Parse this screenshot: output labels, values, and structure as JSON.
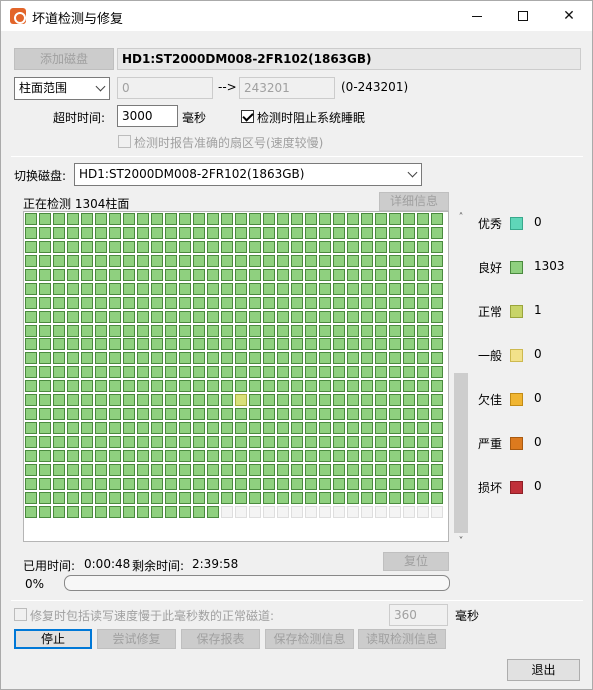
{
  "window": {
    "title": "坏道检测与修复",
    "minimize": "",
    "maximize": "",
    "close": "✕"
  },
  "top": {
    "add_disk_label": "添加磁盘",
    "disk_name": "HD1:ST2000DM008-2FR102(1863GB)",
    "range_mode": "柱面范围",
    "range_start": "0",
    "range_arrow": "-->",
    "range_end": "243201",
    "range_note": "(0-243201)",
    "timeout_label": "超时时间:",
    "timeout_value": "3000",
    "timeout_unit": "毫秒",
    "prevent_sleep_label": "检测时阻止系统睡眠",
    "prevent_sleep_checked": true,
    "report_sector_label": "检测时报告准确的扇区号(速度较慢)",
    "report_sector_checked": false
  },
  "switch": {
    "label": "切换磁盘:",
    "selected": "HD1:ST2000DM008-2FR102(1863GB)"
  },
  "status": {
    "checking_text": "正在检测 1304柱面",
    "details_button": "详细信息"
  },
  "grid": {
    "columns": 30,
    "rows": 22,
    "filled_cells": 1304,
    "normal_cell_index": 1307,
    "total_visible_cells": 660
  },
  "legend": [
    {
      "label": "优秀",
      "color": "#5fd6b8",
      "border": "#38a98c",
      "value": "0"
    },
    {
      "label": "良好",
      "color": "#8fd07f",
      "border": "#4a8a3e",
      "value": "1303"
    },
    {
      "label": "正常",
      "color": "#c8d468",
      "border": "#9aa53c",
      "value": "1"
    },
    {
      "label": "一般",
      "color": "#f2e18a",
      "border": "#cdb94f",
      "value": "0"
    },
    {
      "label": "欠佳",
      "color": "#f0b531",
      "border": "#c28b15",
      "value": "0"
    },
    {
      "label": "严重",
      "color": "#dc7a1e",
      "border": "#a95a10",
      "value": "0"
    },
    {
      "label": "损坏",
      "color": "#c0303a",
      "border": "#8e1f26",
      "value": "0"
    }
  ],
  "timing": {
    "elapsed_label": "已用时间:",
    "elapsed_value": "0:00:48",
    "remaining_label": "剩余时间:",
    "remaining_value": "2:39:58",
    "reset_button": "复位"
  },
  "progress": {
    "percent_text": "0%",
    "fraction": 0.0
  },
  "repair": {
    "include_slow_label": "修复时包括读写速度慢于此毫秒数的正常磁道:",
    "include_slow_checked": false,
    "slow_ms_value": "360",
    "slow_ms_unit": "毫秒"
  },
  "actions": {
    "stop": "停止",
    "try_repair": "尝试修复",
    "save_report": "保存报表",
    "save_check_info": "保存检测信息",
    "read_check_info": "读取检测信息",
    "exit": "退出"
  },
  "scrollbar": {
    "up": "˄",
    "down": "˅"
  }
}
